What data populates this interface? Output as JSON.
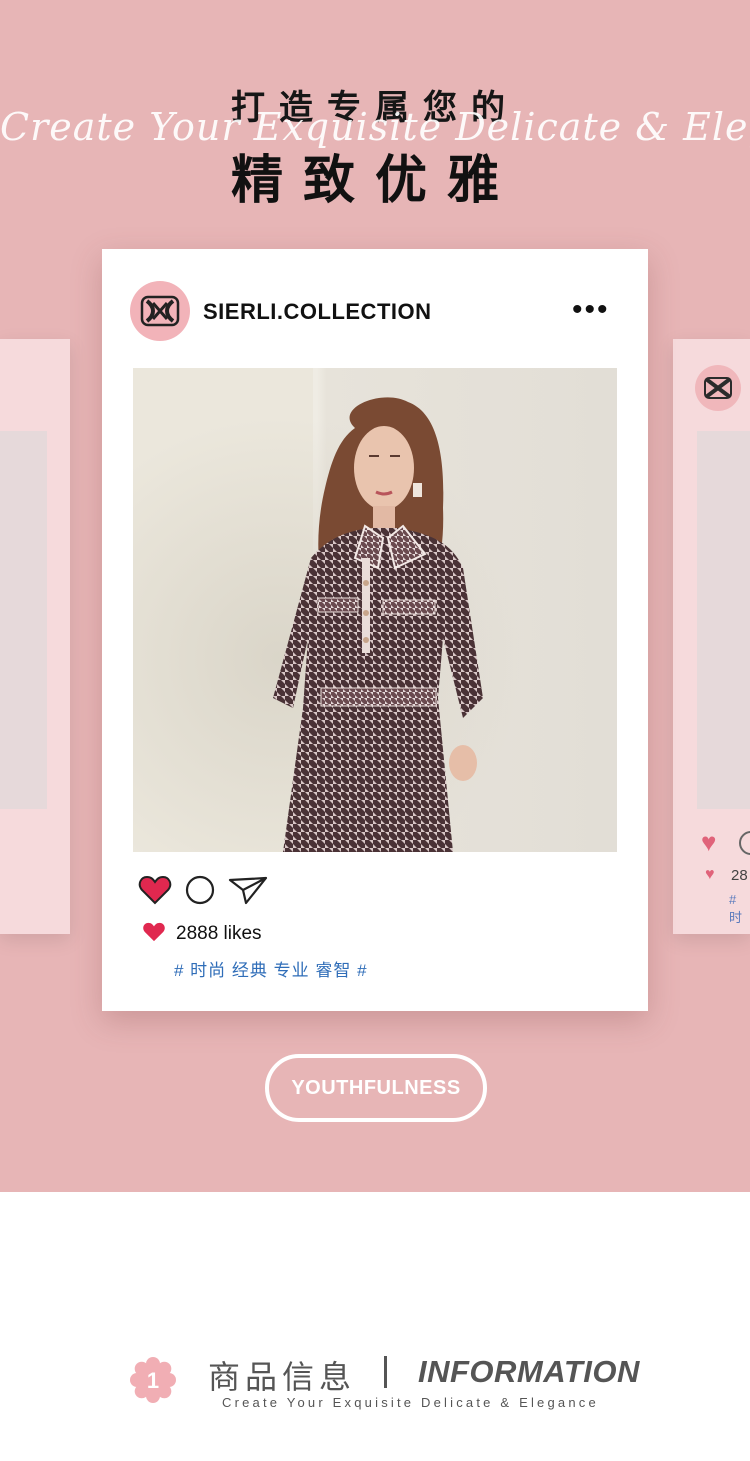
{
  "hero": {
    "headline_small": "打造专属您的",
    "headline_script": "Create Your Exquisite Delicate & Elegance",
    "headline_big": "精致优雅",
    "background": "#e7b5b6"
  },
  "post": {
    "username": "SIERLI.COLLECTION",
    "more_label": "•••",
    "likes": "2888 likes",
    "tags": "# 时尚 经典 专业 睿智 #",
    "heart_color": "#e0284f",
    "tag_color": "#2f6db8"
  },
  "ghost_right": {
    "likes_partial": "28",
    "tag_partial": "# 时"
  },
  "badge": {
    "label": "YOUTHFULNESS"
  },
  "section": {
    "number": "1",
    "title_cn": "商品信息",
    "title_en": "INFORMATION",
    "subtitle": "Create Your Exquisite Delicate & Elegance"
  }
}
